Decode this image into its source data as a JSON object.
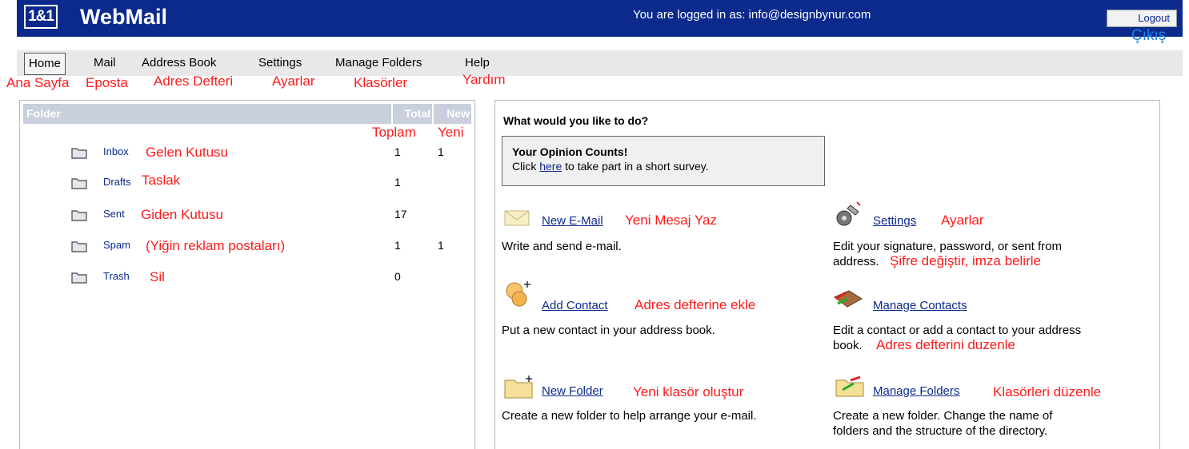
{
  "header": {
    "logo": "1&1",
    "brand": "WebMail",
    "logged_in": "You are logged in as: info@designbynur.com",
    "logout_label": "Logout",
    "logout_tr": "Çıkış"
  },
  "nav": {
    "items": [
      {
        "label": "Home",
        "tr": "Ana Sayfa"
      },
      {
        "label": "Mail",
        "tr": "Eposta"
      },
      {
        "label": "Address Book",
        "tr": "Adres Defteri"
      },
      {
        "label": "Settings",
        "tr": "Ayarlar"
      },
      {
        "label": "Manage Folders",
        "tr": "Klasörler"
      },
      {
        "label": "Help",
        "tr": "Yardım"
      }
    ]
  },
  "folders": {
    "headers": {
      "folder": "Folder",
      "total": "Total",
      "new": "New",
      "total_tr": "Toplam",
      "new_tr": "Yeni"
    },
    "rows": [
      {
        "name": "Inbox",
        "tr": "Gelen Kutusu",
        "total": "1",
        "new": "1"
      },
      {
        "name": "Drafts",
        "tr": "Taslak",
        "total": "1",
        "new": ""
      },
      {
        "name": "Sent",
        "tr": "Giden Kutusu",
        "total": "17",
        "new": ""
      },
      {
        "name": "Spam",
        "tr": "(Yiğin reklam postaları)",
        "total": "1",
        "new": "1"
      },
      {
        "name": "Trash",
        "tr": "Sil",
        "total": "0",
        "new": ""
      }
    ]
  },
  "main": {
    "heading": "What would you like to do?",
    "survey": {
      "title": "Your Opinion Counts!",
      "pre": "Click",
      "link": "here",
      "post": " to take part in a short survey."
    },
    "actions": {
      "new_email": {
        "label": "New E-Mail",
        "tr": "Yeni Mesaj Yaz",
        "desc": "Write and send e-mail."
      },
      "settings": {
        "label": "Settings",
        "tr": "Ayarlar",
        "desc1": "Edit your signature, password, or sent from",
        "desc2": "address.",
        "tr2": "Şifre değiştir, imza belirle"
      },
      "add_contact": {
        "label": "Add Contact",
        "tr": "Adres defterine ekle",
        "desc": "Put a new contact in your address book."
      },
      "manage_contacts": {
        "label": "Manage Contacts",
        "desc1": "Edit a contact or add a contact to your address",
        "desc2": "book.",
        "tr2": "Adres defterini duzenle"
      },
      "new_folder": {
        "label": "New Folder",
        "tr": "Yeni klasör oluştur",
        "desc": "Create a new folder to help arrange your e-mail."
      },
      "manage_folders": {
        "label": "Manage Folders",
        "tr": "Klasörleri düzenle",
        "desc1": "Create a new folder. Change the name of",
        "desc2": "folders and the structure of the directory."
      }
    }
  },
  "colors": {
    "header_bg": "#0b2a8c",
    "annotation_red": "#ff1a1a",
    "link_blue": "#0b2a8c",
    "table_header": "#c9cfdc"
  }
}
